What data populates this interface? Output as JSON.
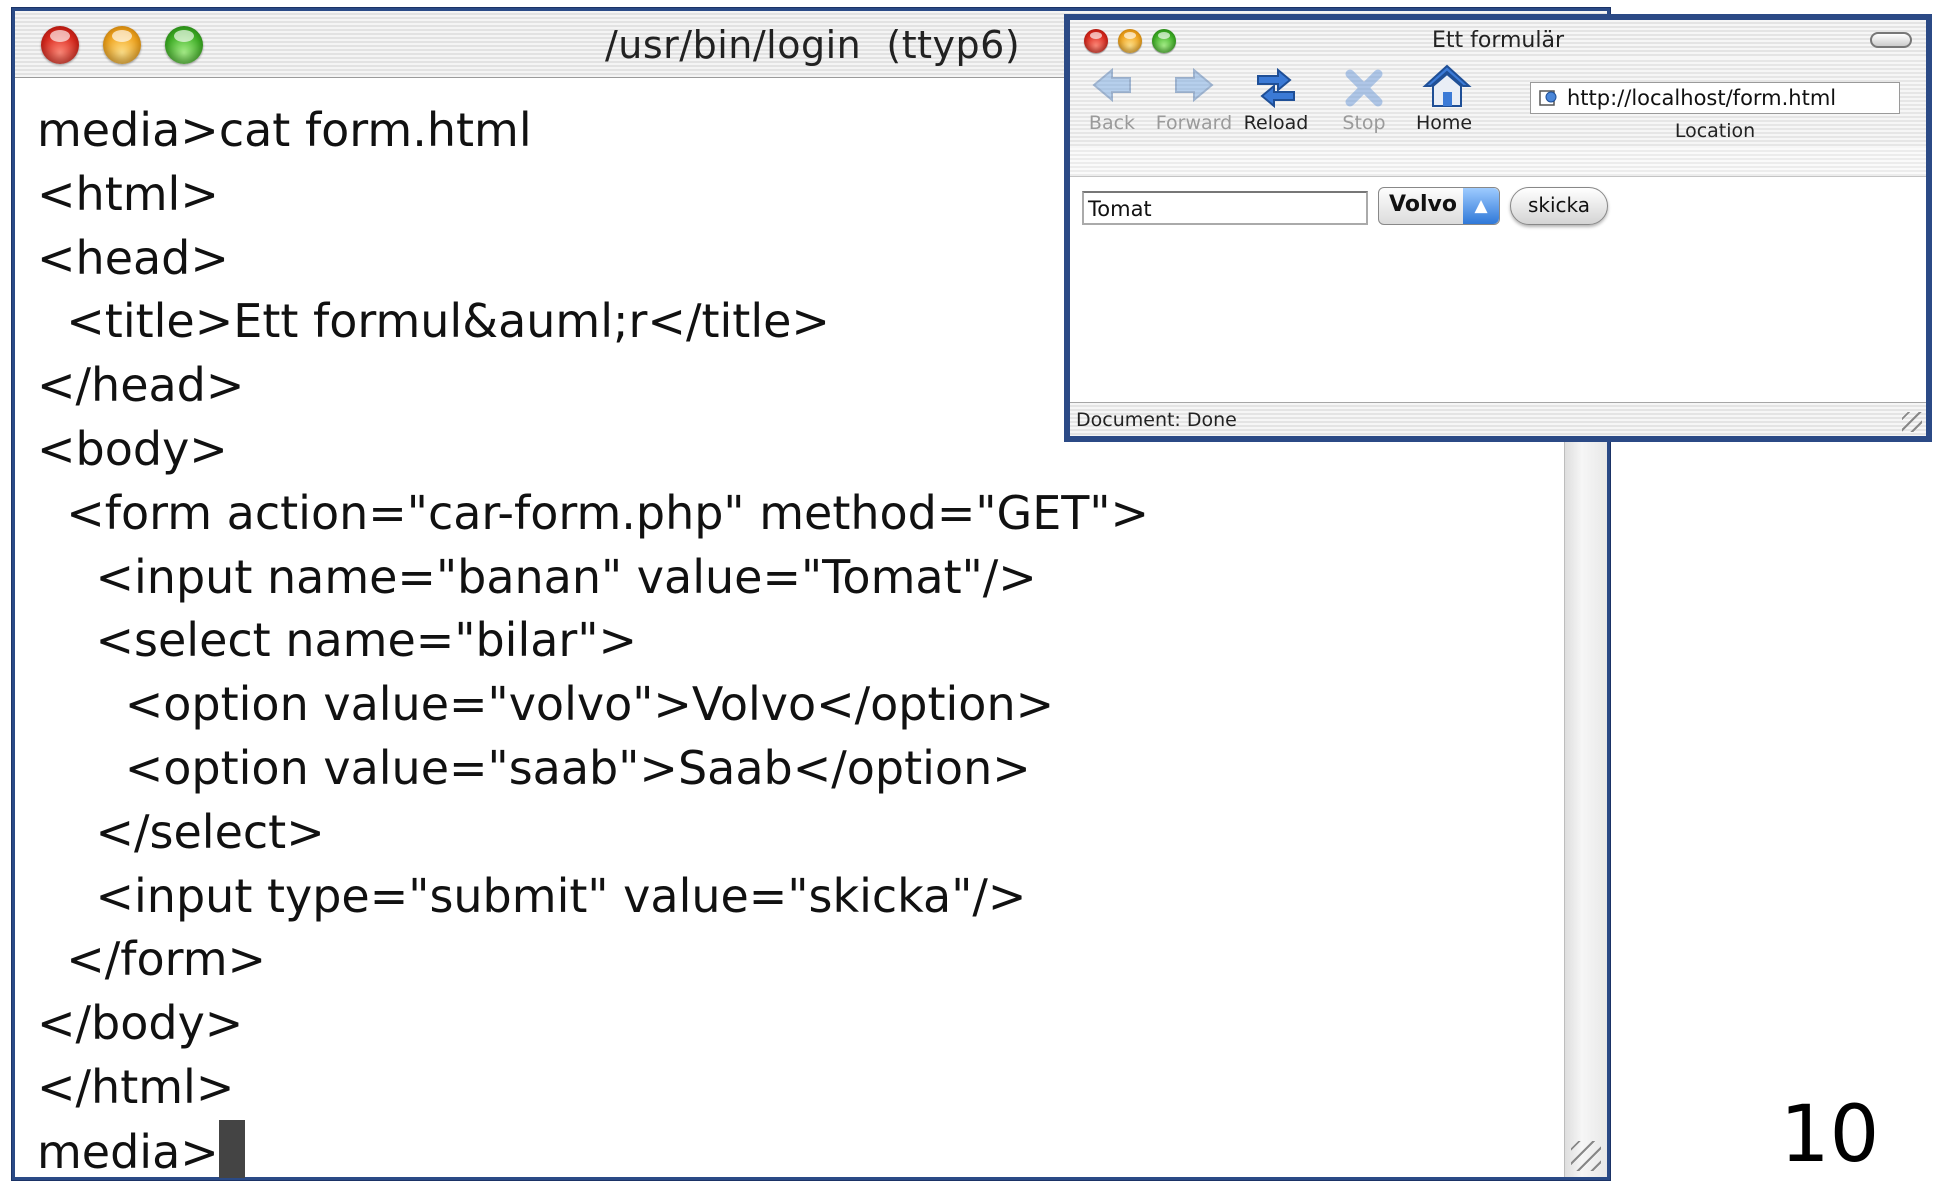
{
  "terminal": {
    "title": "/usr/bin/login  (ttyp6)",
    "lines": [
      "media>cat form.html",
      "<html>",
      "<head>",
      "  <title>Ett formul&auml;r</title>",
      "</head>",
      "<body>",
      "  <form action=\"car-form.php\" method=\"GET\">",
      "    <input name=\"banan\" value=\"Tomat\"/>",
      "    <select name=\"bilar\">",
      "      <option value=\"volvo\">Volvo</option>",
      "      <option value=\"saab\">Saab</option>",
      "    </select>",
      "    <input type=\"submit\" value=\"skicka\"/>",
      "  </form>",
      "</body>",
      "</html>"
    ],
    "prompt": "media>"
  },
  "browser": {
    "title": "Ett formulär",
    "toolbar": {
      "back": "Back",
      "forward": "Forward",
      "reload": "Reload",
      "stop": "Stop",
      "home": "Home",
      "location_label": "Location",
      "url": "http://localhost/form.html"
    },
    "form": {
      "text_value": "Tomat",
      "select_value": "Volvo",
      "submit_label": "skicka"
    },
    "status": "Document: Done"
  },
  "slide_number": "10",
  "colors": {
    "window_border": "#2b4a86",
    "select_arrow": "#2f78d8"
  },
  "icons": [
    "back-arrow-icon",
    "forward-arrow-icon",
    "reload-icon",
    "stop-icon",
    "home-icon",
    "location-icon"
  ]
}
